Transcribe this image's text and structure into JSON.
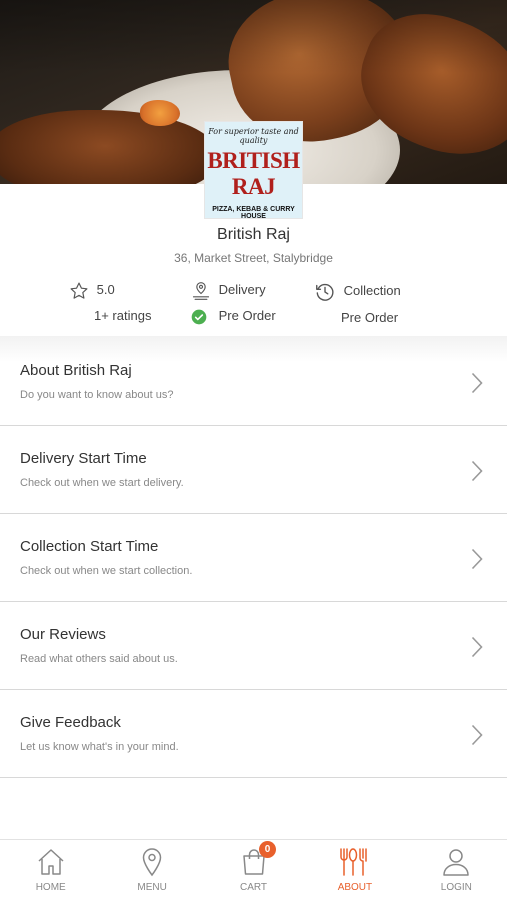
{
  "restaurant": {
    "logo_tagline": "For superior taste and quality",
    "logo_name": "BRITISH RAJ",
    "logo_subtitle": "PIZZA, KEBAB & CURRY HOUSE",
    "name": "British Raj",
    "address": "36, Market Street, Stalybridge"
  },
  "info": {
    "rating": "5.0",
    "ratings_count": "1+ ratings",
    "delivery_label": "Delivery",
    "delivery_status": "Pre Order",
    "collection_label": "Collection",
    "collection_status": "Pre Order"
  },
  "menu_items": [
    {
      "title": "About British Raj",
      "desc": "Do you want to know about us?"
    },
    {
      "title": "Delivery Start Time",
      "desc": "Check out when we start delivery."
    },
    {
      "title": "Collection Start Time",
      "desc": "Check out when we start collection."
    },
    {
      "title": "Our Reviews",
      "desc": "Read what others said about us."
    },
    {
      "title": "Give Feedback",
      "desc": "Let us know what's in your mind."
    }
  ],
  "tabs": [
    {
      "label": "HOME",
      "icon": "home-icon"
    },
    {
      "label": "MENU",
      "icon": "location-pin-icon"
    },
    {
      "label": "CART",
      "icon": "shopping-bag-icon"
    },
    {
      "label": "ABOUT",
      "icon": "cutlery-icon"
    },
    {
      "label": "LOGIN",
      "icon": "user-icon"
    }
  ],
  "cart_count": "0",
  "colors": {
    "accent": "#e8602c",
    "success": "#4caf50",
    "logo_red": "#b0201c"
  }
}
